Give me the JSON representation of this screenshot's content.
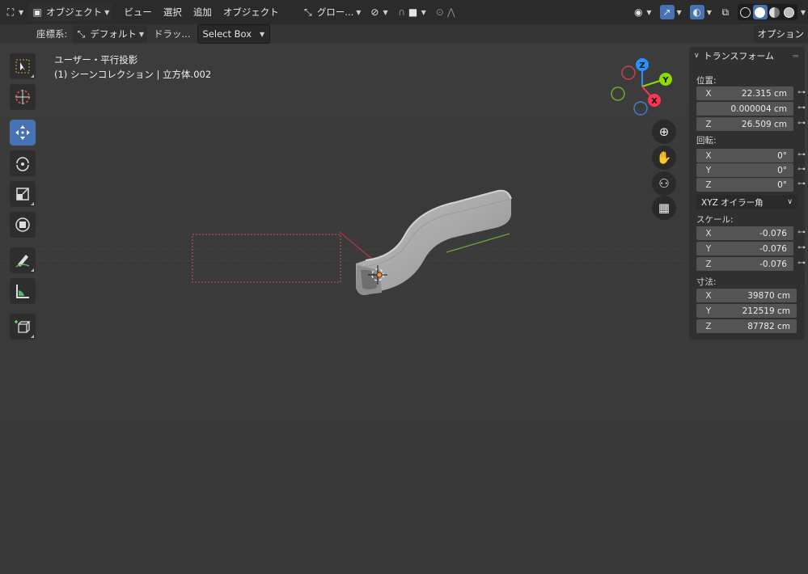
{
  "header": {
    "mode_label": "オブジェクト",
    "menus": [
      "ビュー",
      "選択",
      "追加",
      "オブジェクト"
    ],
    "transform_orientation": "グロー...",
    "options_label": "オプション"
  },
  "tool_settings": {
    "coord_label": "座標系:",
    "coord_value": "デフォルト",
    "drag_label": "ドラッ...",
    "drag_value": "Select Box"
  },
  "viewport": {
    "view_name": "ユーザー・平行投影",
    "collection_info": "(1) シーンコレクション | 立方体.002"
  },
  "gizmo": {
    "z": "Z",
    "y": "Y",
    "x": "X"
  },
  "colors": {
    "accent": "#4772b3",
    "axis_x": "#ff3352",
    "axis_y": "#8bdc00",
    "axis_z": "#2890ff"
  },
  "npanel": {
    "title": "トランスフォーム",
    "location_label": "位置:",
    "location": [
      {
        "axis": "X",
        "value": "22.315 cm"
      },
      {
        "axis": "",
        "value": "0.000004 cm"
      },
      {
        "axis": "Z",
        "value": "26.509 cm"
      }
    ],
    "rotation_label": "回転:",
    "rotation": [
      {
        "axis": "X",
        "value": "0°"
      },
      {
        "axis": "Y",
        "value": "0°"
      },
      {
        "axis": "Z",
        "value": "0°"
      }
    ],
    "rotation_mode": "XYZ オイラー角",
    "scale_label": "スケール:",
    "scale": [
      {
        "axis": "X",
        "value": "-0.076"
      },
      {
        "axis": "Y",
        "value": "-0.076"
      },
      {
        "axis": "Z",
        "value": "-0.076"
      }
    ],
    "dimensions_label": "寸法:",
    "dimensions": [
      {
        "axis": "X",
        "value": "39870 cm"
      },
      {
        "axis": "Y",
        "value": "212519 cm"
      },
      {
        "axis": "Z",
        "value": "87782 cm"
      }
    ]
  },
  "icons": {
    "toolbar": [
      "select-box-icon",
      "cursor-icon",
      "move-icon",
      "rotate-icon",
      "scale-icon",
      "transform-icon",
      "annotate-icon",
      "measure-icon",
      "add-cube-icon"
    ],
    "nav": [
      "zoom-icon",
      "hand-pan-icon",
      "camera-icon",
      "grid-icon"
    ]
  }
}
